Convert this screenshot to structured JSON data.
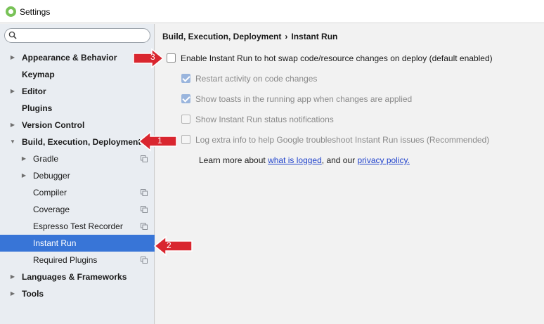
{
  "window": {
    "title": "Settings",
    "icon": "android-studio-icon"
  },
  "search": {
    "placeholder": ""
  },
  "sidebar": {
    "items": [
      {
        "label": "Appearance & Behavior",
        "arrow": "right",
        "bold": true
      },
      {
        "label": "Keymap",
        "bold": true
      },
      {
        "label": "Editor",
        "arrow": "right",
        "bold": true
      },
      {
        "label": "Plugins",
        "bold": true
      },
      {
        "label": "Version Control",
        "arrow": "right",
        "bold": true
      },
      {
        "label": "Build, Execution, Deployment",
        "arrow": "down",
        "bold": true
      },
      {
        "label": "Gradle",
        "arrow": "right",
        "copy_icon": true
      },
      {
        "label": "Debugger",
        "arrow": "right"
      },
      {
        "label": "Compiler",
        "copy_icon": true
      },
      {
        "label": "Coverage",
        "copy_icon": true
      },
      {
        "label": "Espresso Test Recorder",
        "copy_icon": true
      },
      {
        "label": "Instant Run",
        "selected": true
      },
      {
        "label": "Required Plugins",
        "copy_icon": true
      },
      {
        "label": "Languages & Frameworks",
        "arrow": "right",
        "bold": true
      },
      {
        "label": "Tools",
        "arrow": "right",
        "bold": true
      }
    ]
  },
  "breadcrumb": {
    "parent": "Build, Execution, Deployment",
    "separator": "›",
    "current": "Instant Run"
  },
  "options": [
    {
      "label": "Enable Instant Run to hot swap code/resource changes on deploy (default enabled)",
      "checked": false,
      "enabled": true
    },
    {
      "label": "Restart activity on code changes",
      "checked": true,
      "enabled": false
    },
    {
      "label": "Show toasts in the running app when changes are applied",
      "checked": true,
      "enabled": false
    },
    {
      "label": "Show Instant Run status notifications",
      "checked": false,
      "enabled": false
    },
    {
      "label": "Log extra info to help Google troubleshoot Instant Run issues (Recommended)",
      "checked": false,
      "enabled": false
    }
  ],
  "learn_more": {
    "prefix": "Learn more about ",
    "link1": "what is logged",
    "middle": ", and our ",
    "link2": "privacy policy."
  },
  "callouts": [
    {
      "number": "1",
      "color": "#d9262f"
    },
    {
      "number": "2",
      "color": "#d9262f"
    },
    {
      "number": "3",
      "color": "#d9262f"
    }
  ]
}
